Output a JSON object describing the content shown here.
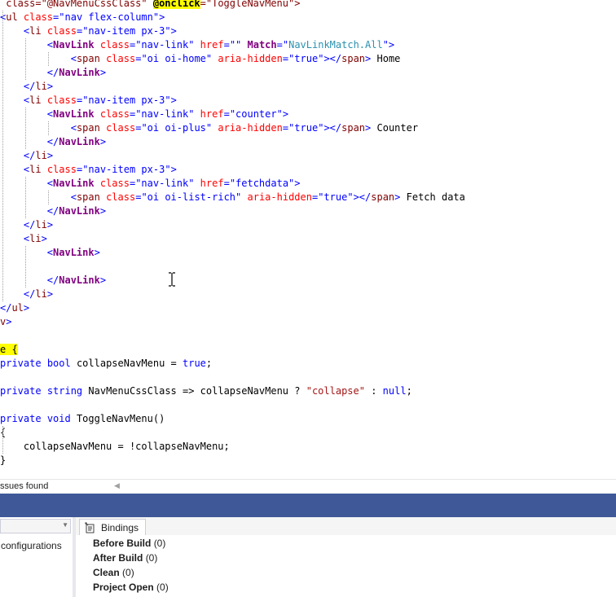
{
  "editor": {
    "lines": [
      [
        [
          "tok-razor-val",
          " class=\"@NavMenuCssClass\" "
        ],
        [
          "tok-directive",
          "@onclick"
        ],
        [
          "tok-razor-val",
          "=\"ToggleNavMenu\">"
        ]
      ],
      [
        [
          "tok-punct",
          "<"
        ],
        [
          "tok-tag",
          "ul"
        ],
        [
          "tok-attr",
          " class"
        ],
        [
          "tok-punct",
          "="
        ],
        [
          "tok-val",
          "\"nav flex-column\""
        ],
        [
          "tok-punct",
          ">"
        ]
      ],
      [
        [
          "tok-plain",
          "    "
        ],
        [
          "tok-punct",
          "<"
        ],
        [
          "tok-tag",
          "li"
        ],
        [
          "tok-attr",
          " class"
        ],
        [
          "tok-punct",
          "="
        ],
        [
          "tok-val",
          "\"nav-item px-3\""
        ],
        [
          "tok-punct",
          ">"
        ]
      ],
      [
        [
          "tok-plain",
          "        "
        ],
        [
          "tok-punct",
          "<"
        ],
        [
          "tok-comp",
          "NavLink"
        ],
        [
          "tok-attr",
          " class"
        ],
        [
          "tok-punct",
          "="
        ],
        [
          "tok-val",
          "\"nav-link\""
        ],
        [
          "tok-attr",
          " href"
        ],
        [
          "tok-punct",
          "="
        ],
        [
          "tok-val",
          "\"\""
        ],
        [
          "tok-plain",
          " "
        ],
        [
          "tok-comp",
          "Match"
        ],
        [
          "tok-punct",
          "="
        ],
        [
          "tok-val",
          "\""
        ],
        [
          "tok-type",
          "NavLinkMatch.All"
        ],
        [
          "tok-val",
          "\""
        ],
        [
          "tok-punct",
          ">"
        ]
      ],
      [
        [
          "tok-plain",
          "            "
        ],
        [
          "tok-punct",
          "<"
        ],
        [
          "tok-tag",
          "span"
        ],
        [
          "tok-attr",
          " class"
        ],
        [
          "tok-punct",
          "="
        ],
        [
          "tok-val",
          "\"oi oi-home\""
        ],
        [
          "tok-attr",
          " aria-hidden"
        ],
        [
          "tok-punct",
          "="
        ],
        [
          "tok-val",
          "\"true\""
        ],
        [
          "tok-punct",
          "></"
        ],
        [
          "tok-tag",
          "span"
        ],
        [
          "tok-punct",
          ">"
        ],
        [
          "tok-plain",
          " Home"
        ]
      ],
      [
        [
          "tok-plain",
          "        "
        ],
        [
          "tok-punct",
          "</"
        ],
        [
          "tok-comp",
          "NavLink"
        ],
        [
          "tok-punct",
          ">"
        ]
      ],
      [
        [
          "tok-plain",
          "    "
        ],
        [
          "tok-punct",
          "</"
        ],
        [
          "tok-tag",
          "li"
        ],
        [
          "tok-punct",
          ">"
        ]
      ],
      [
        [
          "tok-plain",
          "    "
        ],
        [
          "tok-punct",
          "<"
        ],
        [
          "tok-tag",
          "li"
        ],
        [
          "tok-attr",
          " class"
        ],
        [
          "tok-punct",
          "="
        ],
        [
          "tok-val",
          "\"nav-item px-3\""
        ],
        [
          "tok-punct",
          ">"
        ]
      ],
      [
        [
          "tok-plain",
          "        "
        ],
        [
          "tok-punct",
          "<"
        ],
        [
          "tok-comp",
          "NavLink"
        ],
        [
          "tok-attr",
          " class"
        ],
        [
          "tok-punct",
          "="
        ],
        [
          "tok-val",
          "\"nav-link\""
        ],
        [
          "tok-attr",
          " href"
        ],
        [
          "tok-punct",
          "="
        ],
        [
          "tok-val",
          "\"counter\""
        ],
        [
          "tok-punct",
          ">"
        ]
      ],
      [
        [
          "tok-plain",
          "            "
        ],
        [
          "tok-punct",
          "<"
        ],
        [
          "tok-tag",
          "span"
        ],
        [
          "tok-attr",
          " class"
        ],
        [
          "tok-punct",
          "="
        ],
        [
          "tok-val",
          "\"oi oi-plus\""
        ],
        [
          "tok-attr",
          " aria-hidden"
        ],
        [
          "tok-punct",
          "="
        ],
        [
          "tok-val",
          "\"true\""
        ],
        [
          "tok-punct",
          "></"
        ],
        [
          "tok-tag",
          "span"
        ],
        [
          "tok-punct",
          ">"
        ],
        [
          "tok-plain",
          " Counter"
        ]
      ],
      [
        [
          "tok-plain",
          "        "
        ],
        [
          "tok-punct",
          "</"
        ],
        [
          "tok-comp",
          "NavLink"
        ],
        [
          "tok-punct",
          ">"
        ]
      ],
      [
        [
          "tok-plain",
          "    "
        ],
        [
          "tok-punct",
          "</"
        ],
        [
          "tok-tag",
          "li"
        ],
        [
          "tok-punct",
          ">"
        ]
      ],
      [
        [
          "tok-plain",
          "    "
        ],
        [
          "tok-punct",
          "<"
        ],
        [
          "tok-tag",
          "li"
        ],
        [
          "tok-attr",
          " class"
        ],
        [
          "tok-punct",
          "="
        ],
        [
          "tok-val",
          "\"nav-item px-3\""
        ],
        [
          "tok-punct",
          ">"
        ]
      ],
      [
        [
          "tok-plain",
          "        "
        ],
        [
          "tok-punct",
          "<"
        ],
        [
          "tok-comp",
          "NavLink"
        ],
        [
          "tok-attr",
          " class"
        ],
        [
          "tok-punct",
          "="
        ],
        [
          "tok-val",
          "\"nav-link\""
        ],
        [
          "tok-attr",
          " href"
        ],
        [
          "tok-punct",
          "="
        ],
        [
          "tok-val",
          "\"fetchdata\""
        ],
        [
          "tok-punct",
          ">"
        ]
      ],
      [
        [
          "tok-plain",
          "            "
        ],
        [
          "tok-punct",
          "<"
        ],
        [
          "tok-tag",
          "span"
        ],
        [
          "tok-attr",
          " class"
        ],
        [
          "tok-punct",
          "="
        ],
        [
          "tok-val",
          "\"oi oi-list-rich\""
        ],
        [
          "tok-attr",
          " aria-hidden"
        ],
        [
          "tok-punct",
          "="
        ],
        [
          "tok-val",
          "\"true\""
        ],
        [
          "tok-punct",
          "></"
        ],
        [
          "tok-tag",
          "span"
        ],
        [
          "tok-punct",
          ">"
        ],
        [
          "tok-plain",
          " Fetch data"
        ]
      ],
      [
        [
          "tok-plain",
          "        "
        ],
        [
          "tok-punct",
          "</"
        ],
        [
          "tok-comp",
          "NavLink"
        ],
        [
          "tok-punct",
          ">"
        ]
      ],
      [
        [
          "tok-plain",
          "    "
        ],
        [
          "tok-punct",
          "</"
        ],
        [
          "tok-tag",
          "li"
        ],
        [
          "tok-punct",
          ">"
        ]
      ],
      [
        [
          "tok-plain",
          "    "
        ],
        [
          "tok-punct",
          "<"
        ],
        [
          "tok-tag",
          "li"
        ],
        [
          "tok-punct",
          ">"
        ]
      ],
      [
        [
          "tok-plain",
          "        "
        ],
        [
          "tok-punct",
          "<"
        ],
        [
          "tok-comp",
          "NavLink"
        ],
        [
          "tok-punct",
          ">"
        ]
      ],
      [],
      [
        [
          "tok-plain",
          "        "
        ],
        [
          "tok-punct",
          "</"
        ],
        [
          "tok-comp",
          "NavLink"
        ],
        [
          "tok-punct",
          ">"
        ]
      ],
      [
        [
          "tok-plain",
          "    "
        ],
        [
          "tok-punct",
          "</"
        ],
        [
          "tok-tag",
          "li"
        ],
        [
          "tok-punct",
          ">"
        ]
      ],
      [
        [
          "tok-punct",
          "</"
        ],
        [
          "tok-tag",
          "ul"
        ],
        [
          "tok-punct",
          ">"
        ]
      ],
      [
        [
          "tok-tag",
          "v"
        ],
        [
          "tok-punct",
          ">"
        ]
      ],
      [],
      [
        [
          "tok-hl",
          "e {"
        ]
      ],
      [
        [
          "tok-kw",
          "private"
        ],
        [
          "tok-plain",
          " "
        ],
        [
          "tok-kw",
          "bool"
        ],
        [
          "tok-plain",
          " collapseNavMenu = "
        ],
        [
          "tok-kw",
          "true"
        ],
        [
          "tok-plain",
          ";"
        ]
      ],
      [],
      [
        [
          "tok-kw",
          "private"
        ],
        [
          "tok-plain",
          " "
        ],
        [
          "tok-kw",
          "string"
        ],
        [
          "tok-plain",
          " NavMenuCssClass => collapseNavMenu ? "
        ],
        [
          "tok-str",
          "\"collapse\""
        ],
        [
          "tok-plain",
          " : "
        ],
        [
          "tok-kw",
          "null"
        ],
        [
          "tok-plain",
          ";"
        ]
      ],
      [],
      [
        [
          "tok-kw",
          "private"
        ],
        [
          "tok-plain",
          " "
        ],
        [
          "tok-kw",
          "void"
        ],
        [
          "tok-plain",
          " ToggleNavMenu()"
        ]
      ],
      [
        [
          "tok-plain",
          "{"
        ]
      ],
      [
        [
          "tok-plain",
          "    collapseNavMenu = !collapseNavMenu;"
        ]
      ],
      [
        [
          "tok-plain",
          "}"
        ]
      ]
    ]
  },
  "status": {
    "issues": "ssues found"
  },
  "bottom": {
    "left_label": "configurations",
    "tab_label": "Bindings",
    "bindings": [
      {
        "name": "Before Build",
        "count": "(0)"
      },
      {
        "name": "After Build",
        "count": "(0)"
      },
      {
        "name": "Clean",
        "count": "(0)"
      },
      {
        "name": "Project Open",
        "count": "(0)"
      }
    ]
  }
}
